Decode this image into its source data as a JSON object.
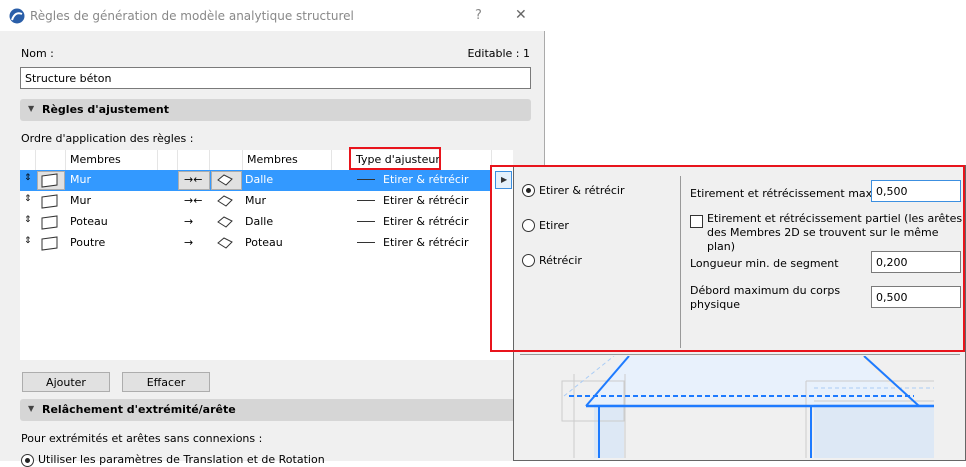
{
  "dialog": {
    "title": "Règles de génération de modèle analytique structurel",
    "help": "?",
    "close": "✕"
  },
  "name_label": "Nom :",
  "editable": "Editable : 1",
  "name_value": "Structure béton",
  "section1": "Règles d'ajustement",
  "order_label": "Ordre d'application des règles :",
  "table": {
    "headers": {
      "members1": "Membres",
      "members2": "Membres",
      "type": "Type d'ajusteur"
    },
    "rows": [
      {
        "member1": "Mur",
        "arrow": "→←",
        "member2": "Dalle",
        "type": "Etirer & rétrécir",
        "selected": true
      },
      {
        "member1": "Mur",
        "arrow": "→←",
        "member2": "Mur",
        "type": "Etirer & rétrécir",
        "selected": false
      },
      {
        "member1": "Poteau",
        "arrow": "→",
        "member2": "Dalle",
        "type": "Etirer & rétrécir",
        "selected": false
      },
      {
        "member1": "Poutre",
        "arrow": "→",
        "member2": "Poteau",
        "type": "Etirer & rétrécir",
        "selected": false
      }
    ]
  },
  "buttons": {
    "add": "Ajouter",
    "delete": "Effacer"
  },
  "section2": "Relâchement d'extrémité/arête",
  "no_conn_label": "Pour extrémités et arêtes sans connexions :",
  "bottom_option": "Utiliser les paramètres de Translation et de Rotation",
  "popup": {
    "options": [
      "Etirer & rétrécir",
      "Etirer",
      "Rétrécir"
    ],
    "selected": 0,
    "max_label": "Etirement et rétrécissement max.",
    "max_value": "0,500",
    "partial_label": "Etirement et rétrécissement partiel (les arêtes des Membres 2D se trouvent sur le même plan)",
    "partial_checked": false,
    "minseg_label": "Longueur min. de segment",
    "minseg_value": "0,200",
    "overhang_label": "Débord maximum du corps physique",
    "overhang_value": "0,500"
  },
  "colors": {
    "selection": "#3399ff",
    "highlight": "#e8141c",
    "preview": "#1e7bff"
  }
}
